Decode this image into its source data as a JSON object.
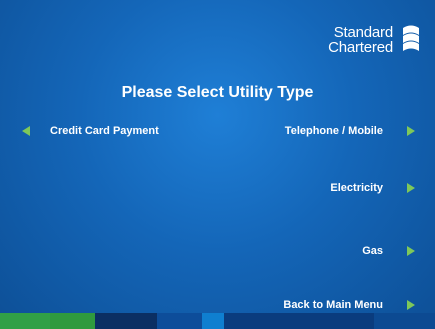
{
  "brand": {
    "line1": "Standard",
    "line2": "Chartered",
    "mark_icon": "standard-chartered-logo-icon"
  },
  "title": "Please Select Utility Type",
  "options": {
    "left": [
      {
        "label": "Credit Card Payment",
        "icon": "arrow-left-icon"
      }
    ],
    "right": [
      {
        "label": "Telephone / Mobile",
        "icon": "arrow-right-icon"
      },
      {
        "label": "Electricity",
        "icon": "arrow-right-icon"
      },
      {
        "label": "Gas",
        "icon": "arrow-right-icon"
      },
      {
        "label": "Back to Main Menu",
        "icon": "arrow-right-icon"
      }
    ]
  },
  "colors": {
    "background": "#1466b8",
    "arrow": "#7ec85a",
    "bar_segments": [
      "#31a046",
      "#2f9a3e",
      "#0b2f63",
      "#0d4d9a",
      "#0f7fd0",
      "#0a3c7e",
      "#0c4a92"
    ]
  }
}
